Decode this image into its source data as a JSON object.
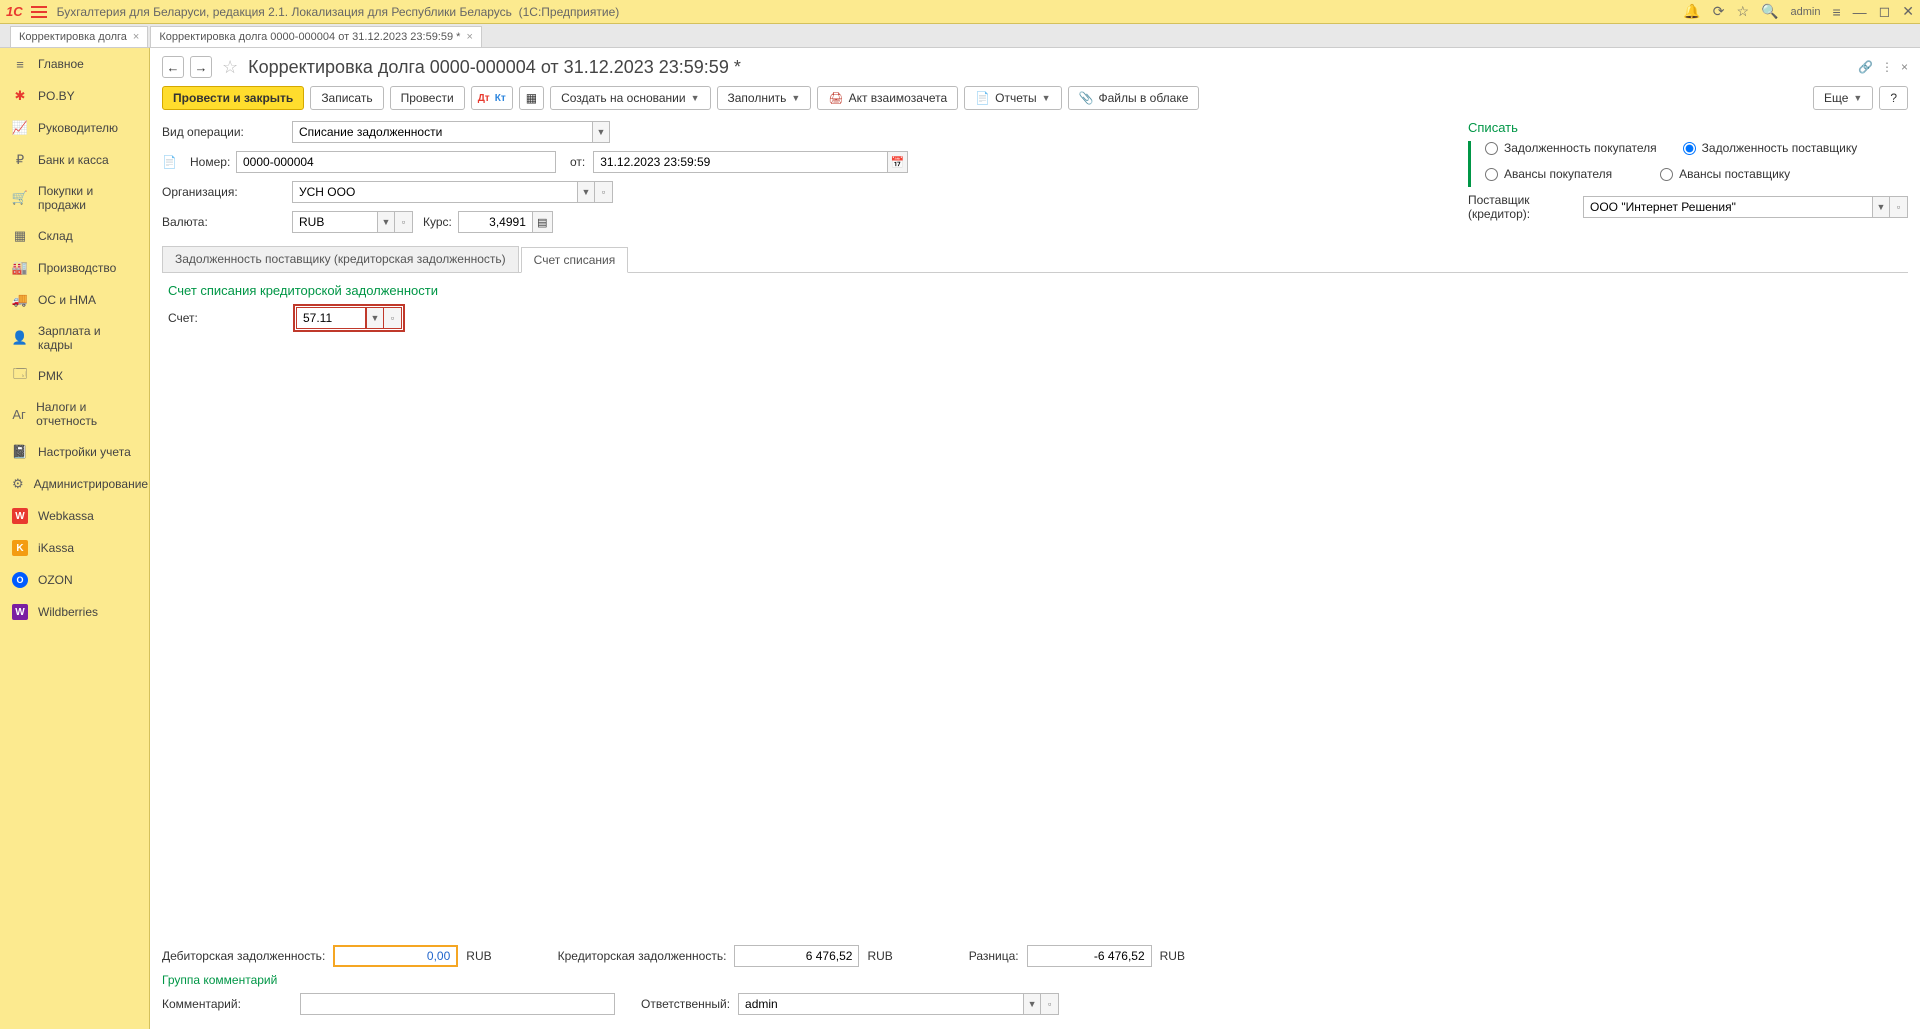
{
  "titlebar": {
    "app_title": "Бухгалтерия для Беларуси, редакция 2.1. Локализация для Республики Беларусь",
    "platform": "(1С:Предприятие)",
    "user": "admin"
  },
  "tabs": [
    {
      "label": "Корректировка долга"
    },
    {
      "label": "Корректировка долга 0000-000004 от 31.12.2023 23:59:59 *"
    }
  ],
  "sidebar": [
    {
      "label": "Главное",
      "icon": "≡"
    },
    {
      "label": "PO.BY",
      "icon": "✱"
    },
    {
      "label": "Руководителю",
      "icon": "📈"
    },
    {
      "label": "Банк и касса",
      "icon": "₽"
    },
    {
      "label": "Покупки и продажи",
      "icon": "🛒"
    },
    {
      "label": "Склад",
      "icon": "▦"
    },
    {
      "label": "Производство",
      "icon": "🏭"
    },
    {
      "label": "ОС и НМА",
      "icon": "🚚"
    },
    {
      "label": "Зарплата и кадры",
      "icon": "👤"
    },
    {
      "label": "РМК",
      "icon": "🗔"
    },
    {
      "label": "Налоги и отчетность",
      "icon": "Aг"
    },
    {
      "label": "Настройки учета",
      "icon": "📓"
    },
    {
      "label": "Администрирование",
      "icon": "⚙"
    },
    {
      "label": "Webkassa",
      "icon": "W"
    },
    {
      "label": "iKassa",
      "icon": "K"
    },
    {
      "label": "OZON",
      "icon": "O"
    },
    {
      "label": "Wildberries",
      "icon": "W"
    }
  ],
  "doc": {
    "title": "Корректировка долга 0000-000004 от 31.12.2023 23:59:59 *"
  },
  "toolbar": {
    "post_and_close": "Провести и закрыть",
    "save": "Записать",
    "post": "Провести",
    "create_based": "Создать на основании",
    "fill": "Заполнить",
    "act": "Акт взаимозачета",
    "reports": "Отчеты",
    "cloud_files": "Файлы в облаке",
    "more": "Еще",
    "help": "?"
  },
  "form": {
    "operation_label": "Вид операции:",
    "operation_value": "Списание задолженности",
    "number_label": "Номер:",
    "number_value": "0000-000004",
    "from_label": "от:",
    "date_value": "31.12.2023 23:59:59",
    "org_label": "Организация:",
    "org_value": "УСН ООО",
    "currency_label": "Валюта:",
    "currency_value": "RUB",
    "rate_label": "Курс:",
    "rate_value": "3,4991"
  },
  "writeoff": {
    "title": "Списать",
    "buyer_debt": "Задолженность покупателя",
    "supplier_debt": "Задолженность поставщику",
    "buyer_advance": "Авансы покупателя",
    "supplier_advance": "Авансы поставщику",
    "supplier_label": "Поставщик (кредитор):",
    "supplier_value": "ООО \"Интернет Решения\""
  },
  "inner_tabs": {
    "tab1": "Задолженность поставщику (кредиторская задолженность)",
    "tab2": "Счет списания"
  },
  "account_section": {
    "title": "Счет списания кредиторской задолженности",
    "label": "Счет:",
    "value": "57.11"
  },
  "bottom": {
    "debit_label": "Дебиторская задолженность:",
    "debit_value": "0,00",
    "debit_cur": "RUB",
    "credit_label": "Кредиторская задолженность:",
    "credit_value": "6 476,52",
    "credit_cur": "RUB",
    "diff_label": "Разница:",
    "diff_value": "-6 476,52",
    "diff_cur": "RUB",
    "comment_group": "Группа комментарий",
    "comment_label": "Комментарий:",
    "comment_value": "",
    "resp_label": "Ответственный:",
    "resp_value": "admin"
  }
}
